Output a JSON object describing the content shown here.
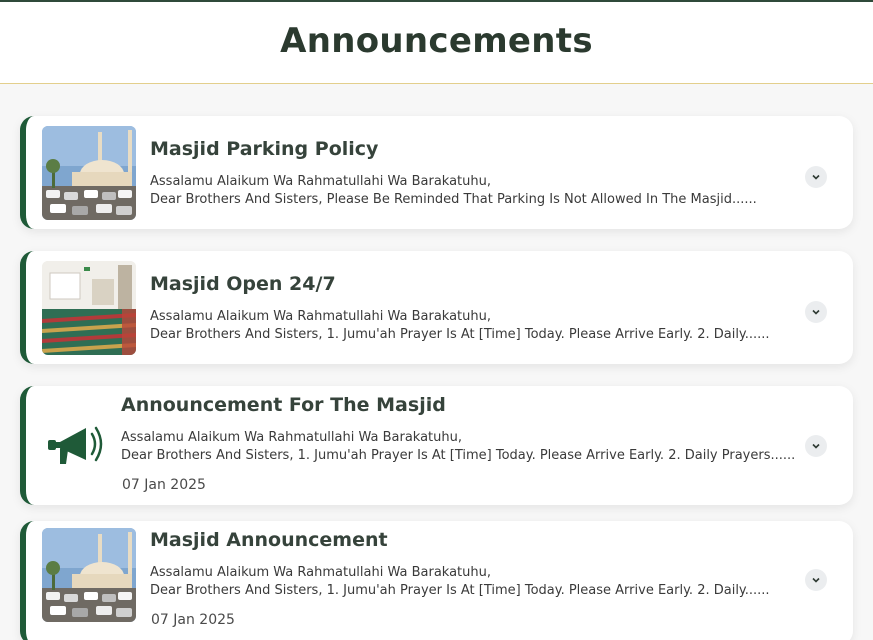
{
  "page": {
    "title": "Announcements"
  },
  "colors": {
    "accent": "#1f5a38",
    "header_rule": "#e3cf8c"
  },
  "announcements": [
    {
      "title": "Masjid Parking Policy",
      "line1": "Assalamu Alaikum Wa Rahmatullahi Wa Barakatuhu,",
      "line2": "Dear Brothers And Sisters, Please Be Reminded That Parking Is Not Allowed In The Masjid......",
      "image": "mosque-exterior-photo"
    },
    {
      "title": "Masjid Open 24/7",
      "line1": "Assalamu Alaikum Wa Rahmatullahi Wa Barakatuhu,",
      "line2": "Dear Brothers And Sisters, 1. Jumu'ah Prayer Is At [Time] Today. Please Arrive Early. 2. Daily......",
      "image": "prayer-hall-photo"
    },
    {
      "title": "Announcement For The Masjid",
      "line1": "Assalamu Alaikum Wa Rahmatullahi Wa Barakatuhu,",
      "line2": "Dear Brothers And Sisters, 1. Jumu'ah Prayer Is At [Time] Today. Please Arrive Early. 2. Daily Prayers......",
      "date": "07 Jan 2025",
      "image": "megaphone-icon"
    },
    {
      "title": "Masjid Announcement",
      "line1": "Assalamu Alaikum Wa Rahmatullahi Wa Barakatuhu,",
      "line2": "Dear Brothers And Sisters, 1. Jumu'ah Prayer Is At [Time] Today. Please Arrive Early. 2. Daily......",
      "date": "07 Jan 2025",
      "image": "mosque-exterior-photo"
    }
  ]
}
